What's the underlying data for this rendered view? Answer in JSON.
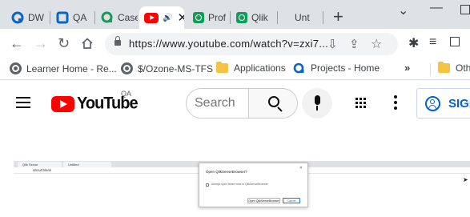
{
  "tabs": [
    {
      "label": "DW",
      "icon": "qlik-q-icon"
    },
    {
      "label": "QA",
      "icon": "qlik-q-icon"
    },
    {
      "label": "Case",
      "icon": "qlik-green-icon"
    },
    {
      "label": "",
      "icon": "youtube-icon",
      "active": true
    },
    {
      "label": "Prof",
      "icon": "green-search-icon"
    },
    {
      "label": "Qlik",
      "icon": "green-search-icon"
    },
    {
      "label": "Unt",
      "icon": ""
    }
  ],
  "new_tab_label": "+",
  "toolbar": {
    "url": "https://www.youtube.com/watch?v=zxi7..."
  },
  "bookmarks": [
    {
      "label": "Learner Home - Re...",
      "icon": "globe-icon"
    },
    {
      "label": "$/Ozone-MS-TFS",
      "icon": "globe-icon"
    },
    {
      "label": "Applications",
      "icon": "folder-icon"
    },
    {
      "label": "Projects - Home",
      "icon": "qlik-q-icon"
    },
    {
      "label": "»",
      "icon": ""
    },
    {
      "label": "Other",
      "icon": "folder-icon"
    }
  ],
  "youtube": {
    "logo_text": "YouTube",
    "region": "QA",
    "search_placeholder": "Search",
    "signin_label": "SIGN IN"
  },
  "video": {
    "mini_tab1": "Qlik Sense",
    "mini_tab2": "Untitled",
    "mini_url": "about:blank",
    "dialog_title": "Open QlikSenseBrowser?",
    "dialog_checkbox": "Always open these links in QlikSenseBrowser",
    "dialog_open": "Open QlikSenseBrowser",
    "dialog_cancel": "Cancel"
  },
  "colors": {
    "youtube_red": "#ff0000",
    "signin_blue": "#065fd4",
    "qlik_green": "#0f9d58",
    "qlik_blue": "#0a66c2"
  }
}
